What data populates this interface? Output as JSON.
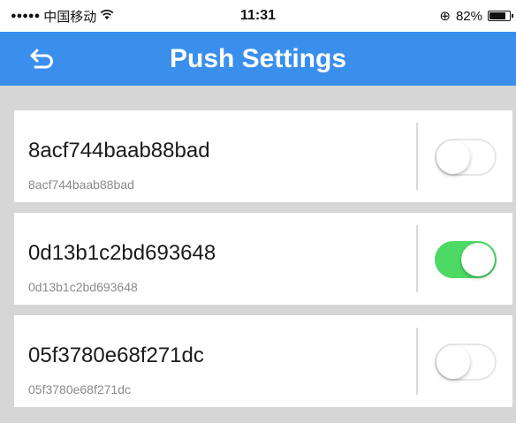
{
  "status_bar": {
    "signal": "●●●●●",
    "carrier": "中国移动",
    "wifi": "ᯤ",
    "time": "11:31",
    "orientation_lock": "⊕",
    "battery_text": "82%",
    "battery_level": 0.82
  },
  "nav": {
    "title": "Push Settings",
    "back_icon": "back-arrow-icon"
  },
  "colors": {
    "nav_bg": "#3a8fec",
    "toggle_on": "#4cd964",
    "page_bg": "#d6d6d6"
  },
  "items": [
    {
      "title": "8acf744baab88bad",
      "subtitle": "8acf744baab88bad",
      "enabled": false
    },
    {
      "title": "0d13b1c2bd693648",
      "subtitle": "0d13b1c2bd693648",
      "enabled": true
    },
    {
      "title": "05f3780e68f271dc",
      "subtitle": "05f3780e68f271dc",
      "enabled": false
    }
  ]
}
